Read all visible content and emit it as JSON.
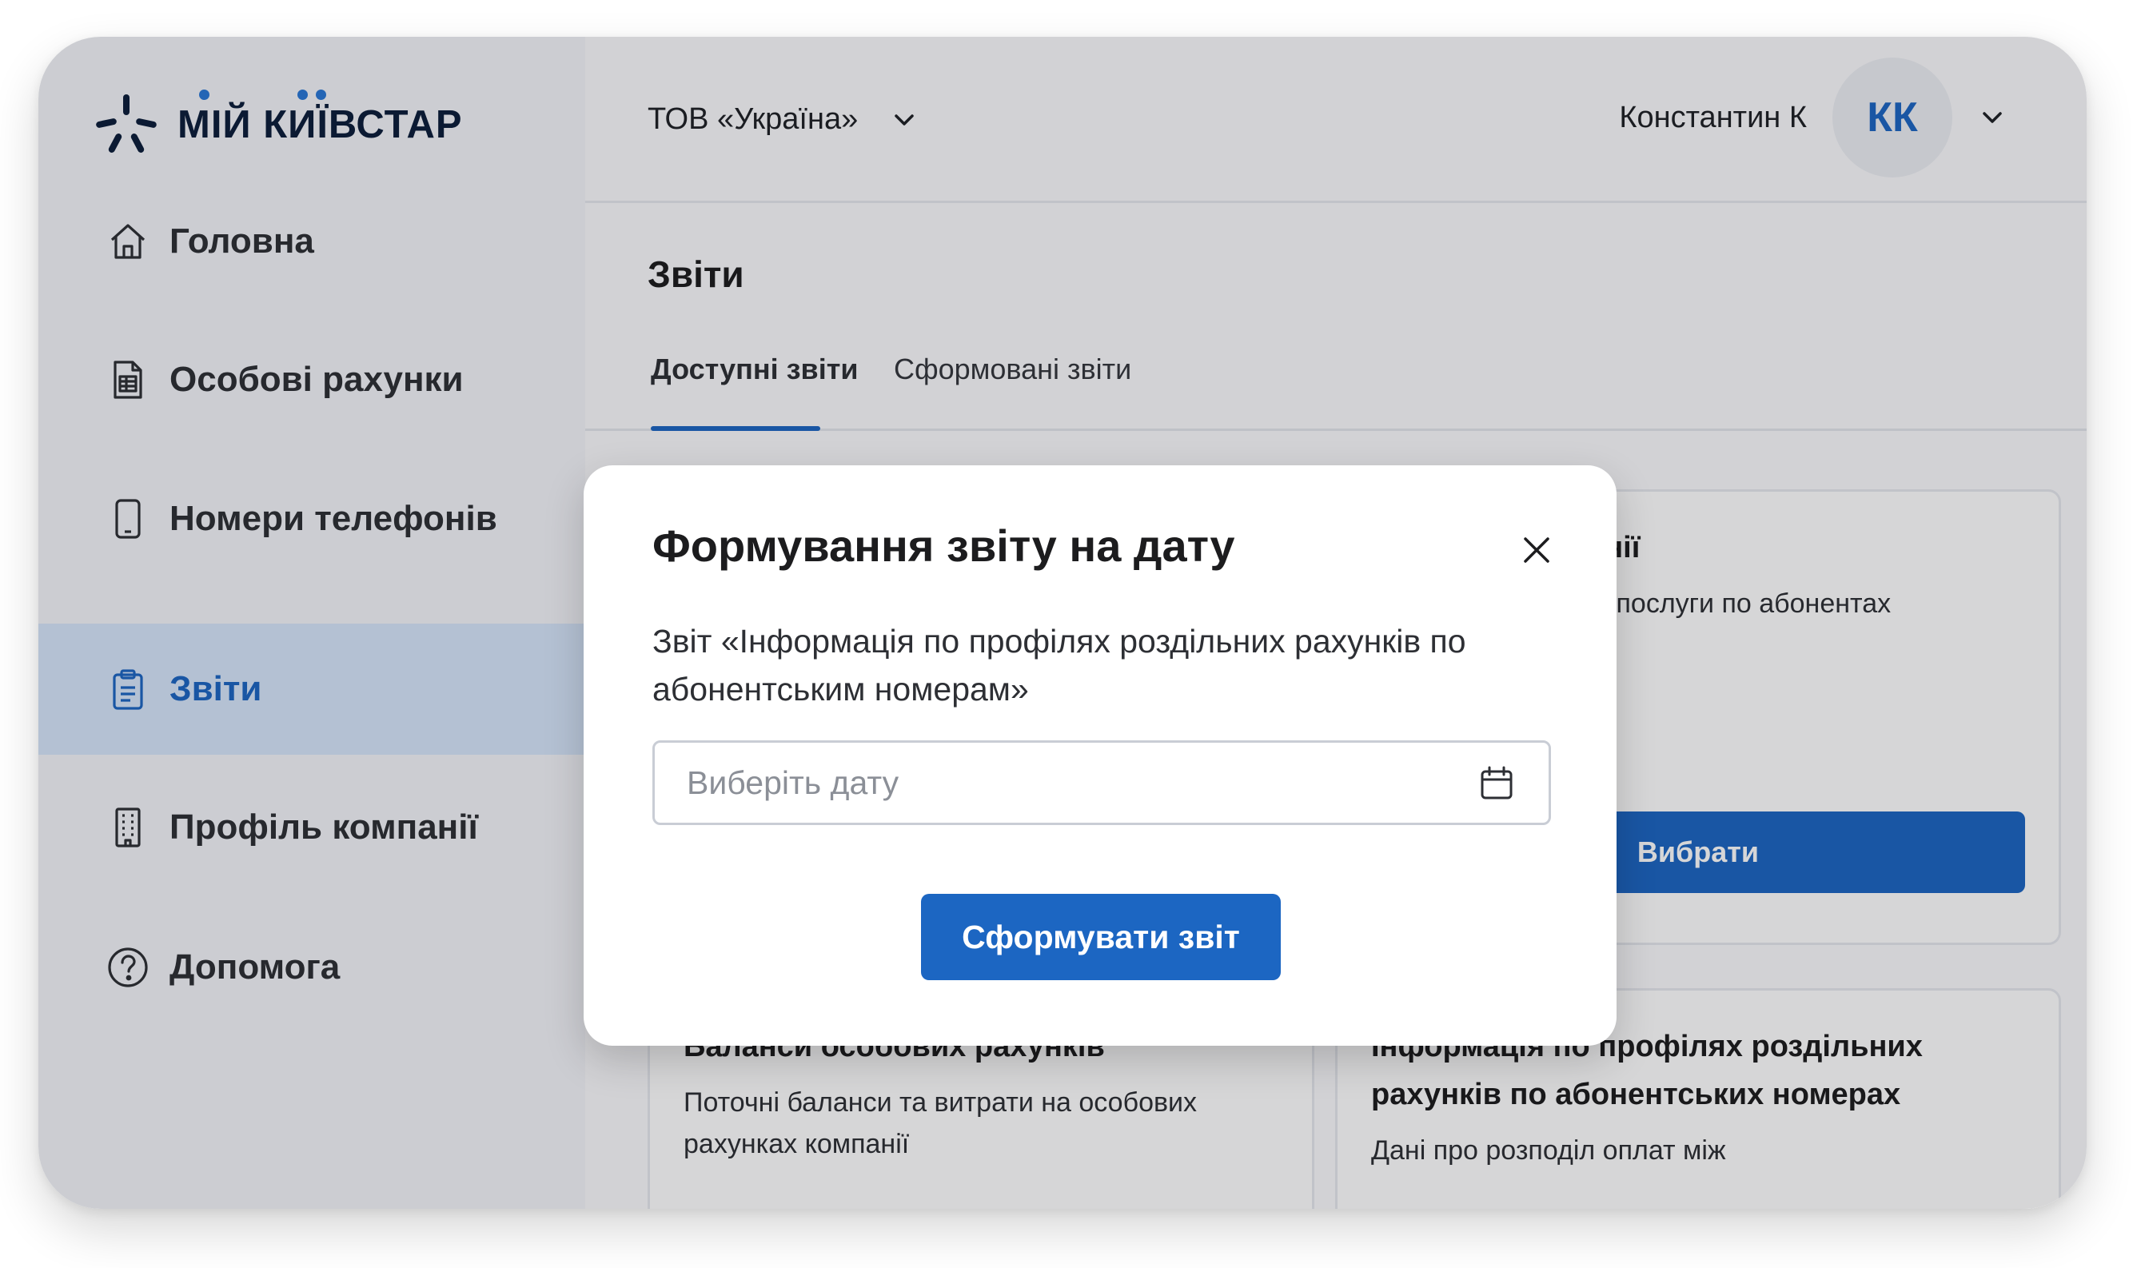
{
  "brand": {
    "logo_text": "МІЙ КИЇВСТАР",
    "accent": "#1c66c2",
    "logo_dot": "#2a77d6"
  },
  "sidebar": {
    "items": [
      {
        "label": "Головна",
        "icon": "home-icon",
        "active": false
      },
      {
        "label": "Особові рахунки",
        "icon": "document-icon",
        "active": false
      },
      {
        "label": "Номери телефонів",
        "icon": "phone-icon",
        "active": false
      },
      {
        "label": "Звіти",
        "icon": "clipboard-icon",
        "active": true
      },
      {
        "label": "Профіль компанії",
        "icon": "building-icon",
        "active": false
      },
      {
        "label": "Допомога",
        "icon": "help-icon",
        "active": false
      }
    ]
  },
  "header": {
    "org_name": "ТОВ «Україна»",
    "user_name": "Константин К",
    "avatar_initials": "КК"
  },
  "page": {
    "title": "Звіти",
    "tabs": [
      {
        "label": "Доступні звіти",
        "active": true
      },
      {
        "label": "Сформовані звіти",
        "active": false
      }
    ]
  },
  "cards": [
    {
      "title_partial": "мпанії",
      "desc_partial": "кети, послуги по абонентах",
      "button_label": "Вибрати"
    },
    {
      "title": "Баланси особових рахунків",
      "desc": "Поточні баланси та витрати на особових рахунках компанії"
    },
    {
      "title": "Інформація по профілях роздільних рахунків по абонентських номерах",
      "desc": "Дані про розподіл оплат між"
    }
  ],
  "modal": {
    "title": "Формування звіту на дату",
    "description": "Звіт «Інформація по профілях роздільних рахунків по абонентським номерам»",
    "date_placeholder": "Виберіть дату",
    "date_value": "",
    "submit_label": "Сформувати звіт"
  }
}
